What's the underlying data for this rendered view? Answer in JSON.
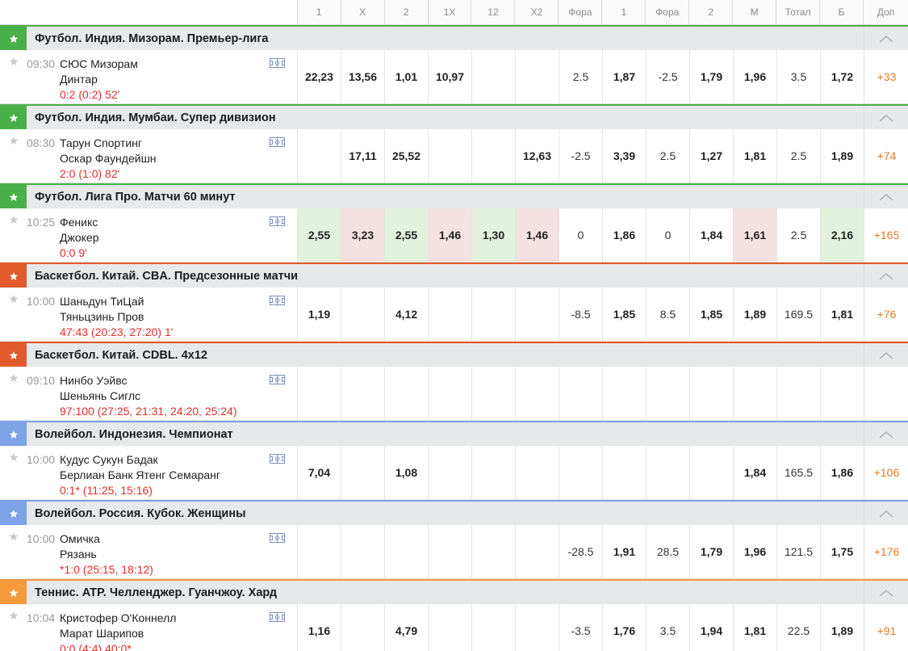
{
  "colors": {
    "football": "#4ab04a",
    "basketball": "#e05a2b",
    "volleyball": "#7da2e6",
    "tennis": "#f39a3b",
    "score": "#e52e2e",
    "dop": "#e07a2a"
  },
  "columns": [
    "1",
    "X",
    "2",
    "1X",
    "12",
    "X2",
    "Фора",
    "1",
    "Фора",
    "2",
    "М",
    "Тотал",
    "Б",
    "Доп"
  ],
  "groups": [
    {
      "name": "Футбол. Индия. Мизорам. Премьер-лига",
      "sport": "football",
      "events": [
        {
          "time": "09:30",
          "team1": "СЮС Мизорам",
          "team2": "Динтар",
          "score": "0:2 (0:2) 52'",
          "cells": [
            "22,23",
            "13,56",
            "1,01",
            "10,97",
            "",
            "",
            "2.5",
            "1,87",
            "-2.5",
            "1,79",
            "1,96",
            "3.5",
            "1,72",
            "+33"
          ],
          "hl": {}
        }
      ]
    },
    {
      "name": "Футбол. Индия. Мумбаи. Супер дивизион",
      "sport": "football",
      "events": [
        {
          "time": "08:30",
          "team1": "Тарун Спортинг",
          "team2": "Оскар Фаундейшн",
          "score": "2:0 (1:0) 82'",
          "cells": [
            "",
            "17,11",
            "25,52",
            "",
            "",
            "12,63",
            "-2.5",
            "3,39",
            "2.5",
            "1,27",
            "1,81",
            "2.5",
            "1,89",
            "+74"
          ],
          "hl": {}
        }
      ]
    },
    {
      "name": "Футбол. Лига Про. Матчи 60 минут",
      "sport": "football",
      "events": [
        {
          "time": "10:25",
          "team1": "Феникс",
          "team2": "Джокер",
          "score": "0:0 9'",
          "cells": [
            "2,55",
            "3,23",
            "2,55",
            "1,46",
            "1,30",
            "1,46",
            "0",
            "1,86",
            "0",
            "1,84",
            "1,61",
            "2.5",
            "2,16",
            "+165"
          ],
          "hl": {
            "0": "green",
            "1": "red",
            "2": "green",
            "3": "red",
            "4": "green",
            "5": "red",
            "10": "red",
            "12": "green"
          }
        }
      ]
    },
    {
      "name": "Баскетбол. Китай. CBA. Предсезонные матчи",
      "sport": "basketball",
      "events": [
        {
          "time": "10:00",
          "team1": "Шаньдун ТиЦай",
          "team2": "Тяньцзинь Пров",
          "score": "47:43 (20:23, 27:20) 1'",
          "cells": [
            "1,19",
            "",
            "4,12",
            "",
            "",
            "",
            "-8.5",
            "1,85",
            "8.5",
            "1,85",
            "1,89",
            "169.5",
            "1,81",
            "+76"
          ],
          "hl": {}
        }
      ]
    },
    {
      "name": "Баскетбол. Китай. CDBL. 4x12",
      "sport": "basketball",
      "events": [
        {
          "time": "09:10",
          "team1": "Нинбо Уэйвс",
          "team2": "Шеньянь Сиглс",
          "score": "97:100 (27:25, 21:31, 24:20, 25:24)",
          "cells": [
            "",
            "",
            "",
            "",
            "",
            "",
            "",
            "",
            "",
            "",
            "",
            "",
            "",
            ""
          ],
          "hl": {}
        }
      ]
    },
    {
      "name": "Волейбол. Индонезия. Чемпионат",
      "sport": "volleyball",
      "events": [
        {
          "time": "10:00",
          "team1": "Кудус Сукун Бадак",
          "team2": "Берлиан Банк Ятенг Семаранг",
          "score": "0:1* (11:25, 15:16)",
          "cells": [
            "7,04",
            "",
            "1,08",
            "",
            "",
            "",
            "",
            "",
            "",
            "",
            "1,84",
            "165.5",
            "1,86",
            "+106"
          ],
          "hl": {}
        }
      ]
    },
    {
      "name": "Волейбол. Россия. Кубок. Женщины",
      "sport": "volleyball",
      "events": [
        {
          "time": "10:00",
          "team1": "Омичка",
          "team2": "Рязань",
          "score": "*1:0 (25:15, 18:12)",
          "cells": [
            "",
            "",
            "",
            "",
            "",
            "",
            "-28.5",
            "1,91",
            "28.5",
            "1,79",
            "1,96",
            "121.5",
            "1,75",
            "+176"
          ],
          "hl": {}
        }
      ]
    },
    {
      "name": "Теннис. ATP. Челленджер. Гуанчжоу. Хард",
      "sport": "tennis",
      "events": [
        {
          "time": "10:04",
          "team1": "Кристофер О'Коннелл",
          "team2": "Марат Шарипов",
          "score": "0:0 (4:4) 40:0*",
          "cells": [
            "1,16",
            "",
            "4,79",
            "",
            "",
            "",
            "-3.5",
            "1,76",
            "3.5",
            "1,94",
            "1,81",
            "22.5",
            "1,89",
            "+91"
          ],
          "hl": {}
        }
      ]
    }
  ]
}
